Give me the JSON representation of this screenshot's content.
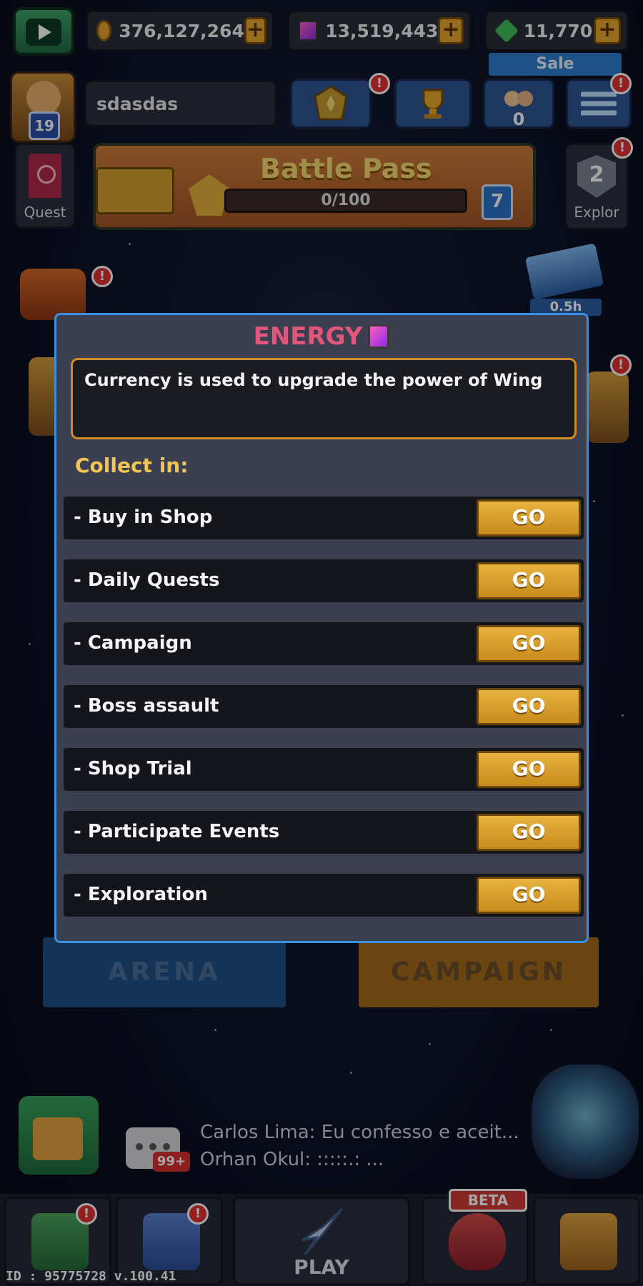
{
  "currencies": {
    "gold": "376,127,264",
    "energy": "13,519,443",
    "gems": "11,770",
    "plus": "+"
  },
  "sale_label": "Sale",
  "profile": {
    "name": "sdasdas",
    "level": "19"
  },
  "hud": {
    "fans_count": "0",
    "alert": "!"
  },
  "quest_label": "Quest",
  "battle_pass": {
    "title": "Battle Pass",
    "progress_text": "0/100",
    "progress": 0,
    "level": "7"
  },
  "exploration": {
    "label": "Explor",
    "count": "2"
  },
  "timer": "0.5h",
  "modes": {
    "arena": "ARENA",
    "campaign": "CAMPAIGN"
  },
  "chat": {
    "count": "99+",
    "line1": "Carlos Lima: Eu confesso e aceit...",
    "line2": "Orhan Okul:          :::::.: ..."
  },
  "nav": {
    "play": "PLAY",
    "beta": "BETA"
  },
  "id_line": "ID : 95775728 v.100.41",
  "modal": {
    "title": "ENERGY",
    "description": "Currency is used to upgrade the power of Wing",
    "collect_title": "Collect in:",
    "go_label": "GO",
    "sources": [
      "- Buy in Shop",
      "- Daily Quests",
      "- Campaign",
      "- Boss assault",
      "- Shop Trial",
      "- Participate Events",
      "- Exploration"
    ]
  },
  "colors": {
    "title_pink": "#e2567c",
    "collect_yellow": "#f1c453",
    "go_gold": "#e8b33e",
    "modal_border": "#3a8fe0"
  }
}
